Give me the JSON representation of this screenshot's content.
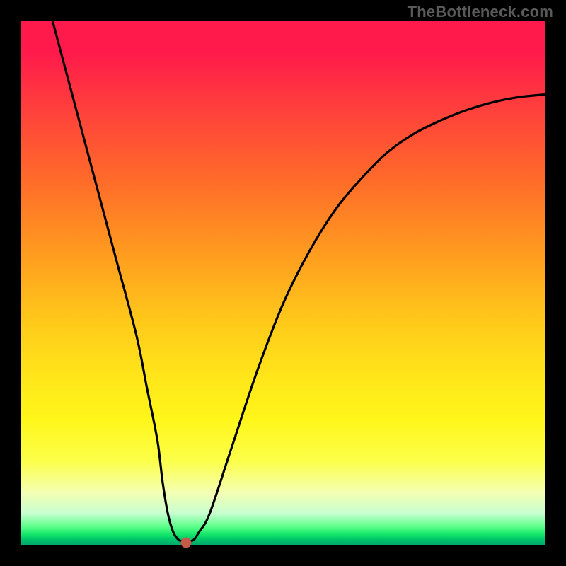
{
  "watermark": "TheBottleneck.com",
  "chart_data": {
    "type": "line",
    "title": "",
    "xlabel": "",
    "ylabel": "",
    "xlim": [
      0,
      100
    ],
    "ylim": [
      0,
      100
    ],
    "series": [
      {
        "name": "bottleneck-curve",
        "x": [
          6,
          10,
          14,
          18,
          22,
          24,
          26,
          27,
          28,
          29,
          30,
          31,
          32,
          33,
          34,
          36,
          40,
          45,
          50,
          55,
          60,
          65,
          70,
          75,
          80,
          85,
          90,
          95,
          100
        ],
        "y": [
          100,
          85,
          70,
          55,
          40,
          30,
          20,
          12,
          6,
          2.5,
          1,
          0.6,
          0.6,
          1,
          2.5,
          6,
          18,
          33,
          46,
          56,
          64,
          70,
          75,
          78.5,
          81,
          83,
          84.5,
          85.5,
          86
        ]
      }
    ],
    "marker": {
      "x": 31.5,
      "y": 0.4,
      "color": "#c35a4a"
    },
    "gradient_stops": [
      {
        "pos": 0,
        "color": "#ff1a4b"
      },
      {
        "pos": 0.3,
        "color": "#ff6a2a"
      },
      {
        "pos": 0.57,
        "color": "#ffc81a"
      },
      {
        "pos": 0.84,
        "color": "#fcff4a"
      },
      {
        "pos": 0.965,
        "color": "#5cff8a"
      },
      {
        "pos": 1.0,
        "color": "#00a86b"
      }
    ]
  }
}
